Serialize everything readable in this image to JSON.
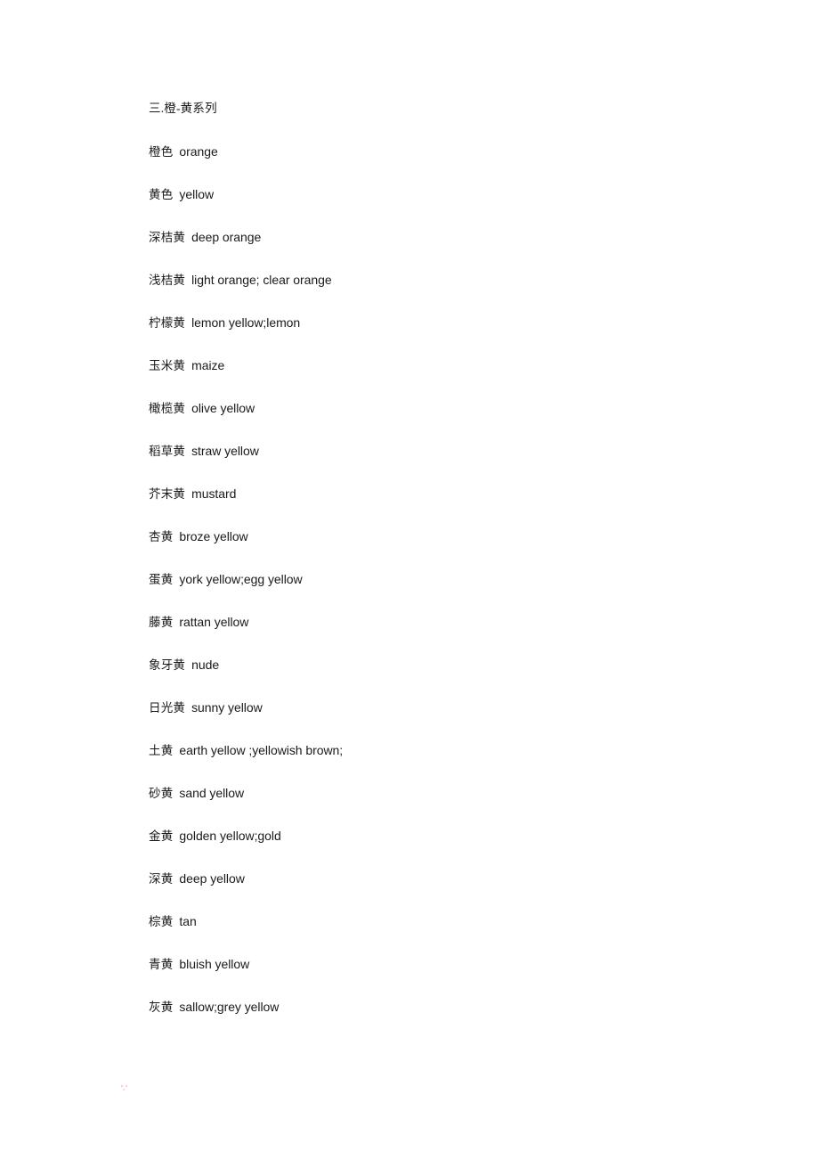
{
  "document": {
    "background_color": "#ffffff",
    "text_color": "#1a1a1a",
    "heading": "三.橙-黄系列",
    "entries": [
      {
        "cn": "橙色",
        "en": "orange"
      },
      {
        "cn": "黄色",
        "en": "yellow"
      },
      {
        "cn": "深桔黄",
        "en": "deep orange"
      },
      {
        "cn": "浅桔黄",
        "en": "light orange; clear orange"
      },
      {
        "cn": "柠檬黄",
        "en": "lemon yellow;lemon"
      },
      {
        "cn": "玉米黄",
        "en": "maize"
      },
      {
        "cn": "橄榄黄",
        "en": "olive yellow"
      },
      {
        "cn": "稻草黄",
        "en": "straw yellow"
      },
      {
        "cn": "芥末黄",
        "en": "mustard"
      },
      {
        "cn": "杏黄",
        "en": "broze yellow"
      },
      {
        "cn": "蛋黄",
        "en": "york yellow;egg yellow"
      },
      {
        "cn": "藤黄",
        "en": "rattan yellow"
      },
      {
        "cn": "象牙黄",
        "en": "nude"
      },
      {
        "cn": "日光黄",
        "en": "sunny yellow"
      },
      {
        "cn": "土黄",
        "en": "earth yellow ;yellowish brown;"
      },
      {
        "cn": "砂黄",
        "en": "sand yellow"
      },
      {
        "cn": "金黄",
        "en": "golden yellow;gold"
      },
      {
        "cn": "深黄",
        "en": "deep yellow"
      },
      {
        "cn": "棕黄",
        "en": "tan"
      },
      {
        "cn": "青黄",
        "en": "bluish yellow"
      },
      {
        "cn": "灰黄",
        "en": "sallow;grey yellow"
      }
    ]
  }
}
